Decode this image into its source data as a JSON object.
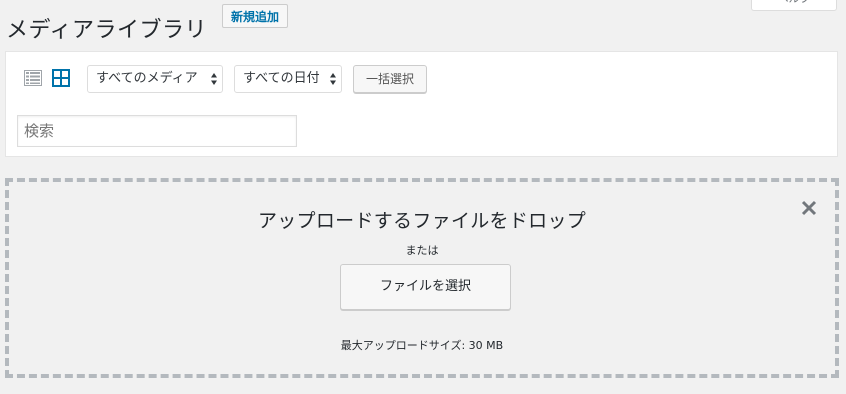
{
  "header": {
    "title": "メディアライブラリ",
    "add_new_label": "新規追加",
    "help_label": "ヘルプ"
  },
  "toolbar": {
    "view_list_icon": "list-view-icon",
    "view_grid_icon": "grid-view-icon",
    "active_view": "grid",
    "media_filter": "すべてのメディア",
    "date_filter": "すべての日付",
    "bulk_select_label": "一括選択",
    "search_placeholder": "検索"
  },
  "uploader": {
    "title": "アップロードするファイルをドロップ",
    "or_text": "または",
    "select_files_label": "ファイルを選択",
    "max_size_text": "最大アップロードサイズ: 30 MB",
    "close_icon": "close-icon"
  },
  "colors": {
    "accent": "#0073aa",
    "background": "#f1f1f1",
    "dashed_border": "#b4b9be"
  }
}
